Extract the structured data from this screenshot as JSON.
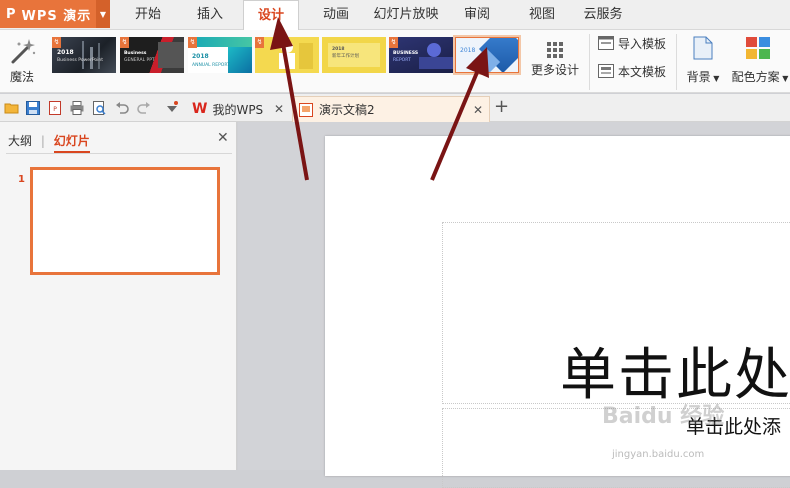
{
  "app": {
    "logo": "P",
    "title": "WPS 演示"
  },
  "menu": {
    "tabs": [
      "开始",
      "插入",
      "设计",
      "动画",
      "幻灯片放映",
      "审阅",
      "视图",
      "云服务"
    ],
    "active_tab": "设计"
  },
  "ribbon": {
    "magic_label": "魔法",
    "templates": [
      {
        "name": "template-dark-city",
        "text": "2018",
        "sub": "Business PowerPoint"
      },
      {
        "name": "template-red-black",
        "text": "Business",
        "sub": "GENERAL PPT"
      },
      {
        "name": "template-annual-report",
        "text": "2018",
        "sub": "ANNUAL REPORT"
      },
      {
        "name": "template-yellow-figure",
        "text": "",
        "sub": ""
      },
      {
        "name": "template-yellow-plain",
        "text": "2018",
        "sub": "新年工作计划"
      },
      {
        "name": "template-navy-business",
        "text": "BUSINESS",
        "sub": "REPORT"
      },
      {
        "name": "template-blue-diamond",
        "text": "2018",
        "sub": ""
      }
    ],
    "more_design_label": "更多设计",
    "import_template_label": "导入模板",
    "this_template_label": "本文模板",
    "background_label": "背景",
    "color_scheme_label": "配色方案"
  },
  "doc_tabs": {
    "my_wps": "我的WPS",
    "document": "演示文稿2"
  },
  "left_panel": {
    "outline_tab": "大纲",
    "slides_tab": "幻灯片",
    "slide_number": "1"
  },
  "slide": {
    "title_placeholder": "单击此处",
    "subtitle_placeholder": "单击此处添"
  },
  "watermark": {
    "text": "Baidu 经验",
    "url": "jingyan.baidu.com"
  },
  "colors": {
    "accent": "#e8743b",
    "active_tab_text": "#d9461f",
    "annotation_arrow": "#7a1414"
  }
}
